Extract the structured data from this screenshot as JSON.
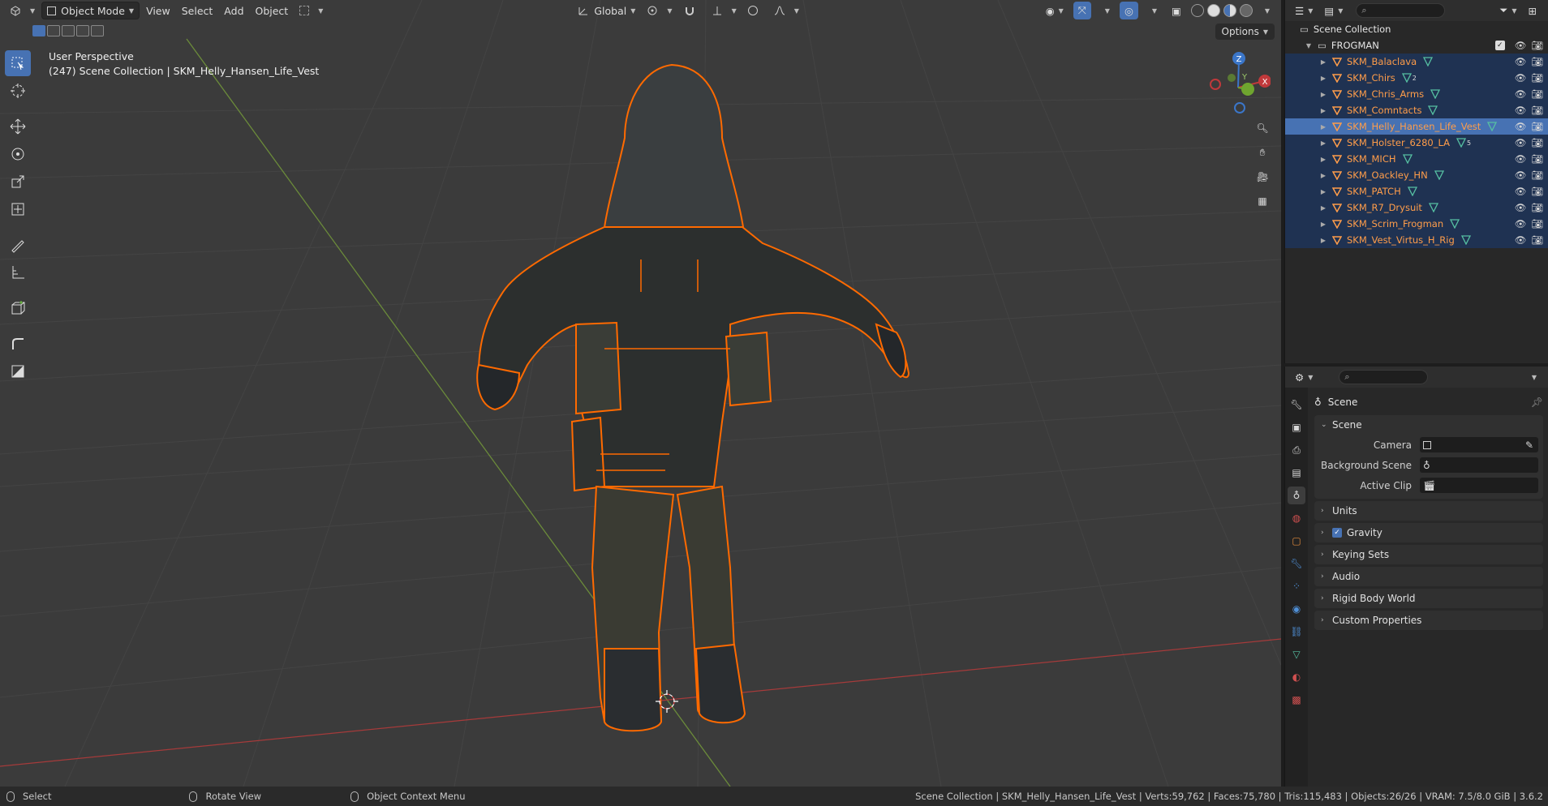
{
  "viewport_header": {
    "editor_icon": "3d-viewport-icon",
    "mode": "Object Mode",
    "menus": [
      "View",
      "Select",
      "Add",
      "Object"
    ],
    "transform_orientation": "Global",
    "options_label": "Options"
  },
  "viewport": {
    "perspective": "User Perspective",
    "collection_info": "(247) Scene Collection | SKM_Helly_Hansen_Life_Vest",
    "gizmo_axes": {
      "x": "X",
      "y": "Y",
      "z": "Z"
    },
    "colors": {
      "background": "#3b3b3b",
      "selection_outline": "#ff6a00",
      "x_axis": "#c0393b",
      "y_axis": "#6fa52f",
      "z_axis": "#3b76c9"
    }
  },
  "toolbar": {
    "tools": [
      "select-box-icon",
      "cursor-icon",
      "move-icon",
      "rotate-icon",
      "scale-icon",
      "transform-icon",
      "annotate-icon",
      "measure-icon",
      "add-cube-icon",
      "extrude-icon",
      "bevel-icon"
    ]
  },
  "outliner": {
    "root": "Scene Collection",
    "collection": "FROGMAN",
    "items": [
      {
        "name": "SKM_Balaclava",
        "count": ""
      },
      {
        "name": "SKM_Chirs",
        "count": "2"
      },
      {
        "name": "SKM_Chris_Arms",
        "count": ""
      },
      {
        "name": "SKM_Comntacts",
        "count": ""
      },
      {
        "name": "SKM_Helly_Hansen_Life_Vest",
        "count": ""
      },
      {
        "name": "SKM_Holster_6280_LA",
        "count": "5"
      },
      {
        "name": "SKM_MICH",
        "count": ""
      },
      {
        "name": "SKM_Oackley_HN",
        "count": ""
      },
      {
        "name": "SKM_PATCH",
        "count": ""
      },
      {
        "name": "SKM_R7_Drysuit",
        "count": ""
      },
      {
        "name": "SKM_Scrim_Frogman",
        "count": ""
      },
      {
        "name": "SKM_Vest_Virtus_H_Rig",
        "count": ""
      }
    ],
    "active_index": 4
  },
  "properties": {
    "context_title": "Scene",
    "panel_title": "Scene",
    "fields": [
      {
        "label": "Camera",
        "value": ""
      },
      {
        "label": "Background Scene",
        "value": ""
      },
      {
        "label": "Active Clip",
        "value": ""
      }
    ],
    "collapsed_panels": [
      "Units",
      "Gravity",
      "Keying Sets",
      "Audio",
      "Rigid Body World",
      "Custom Properties"
    ],
    "gravity_checked": true
  },
  "statusbar": {
    "hints": [
      "Select",
      "Rotate View",
      "Object Context Menu"
    ],
    "stats": "Scene Collection | SKM_Helly_Hansen_Life_Vest | Verts:59,762 | Faces:75,780 | Tris:115,483 | Objects:26/26 | VRAM: 7.5/8.0 GiB | 3.6.2"
  }
}
